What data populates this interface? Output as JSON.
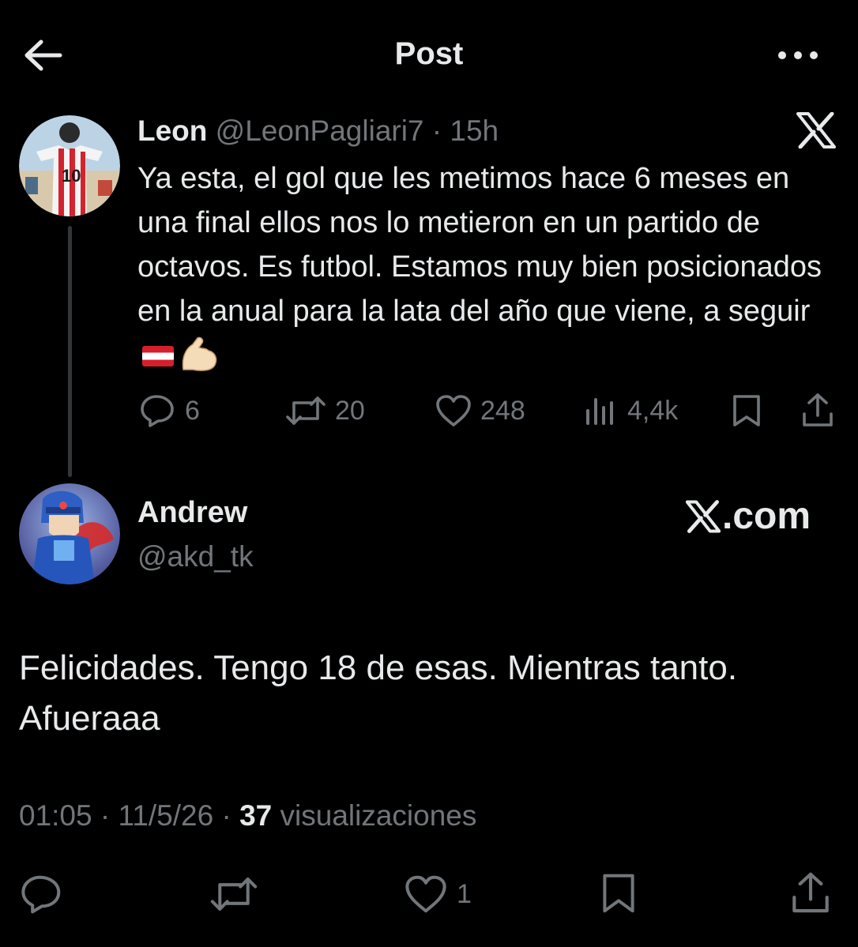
{
  "header": {
    "title": "Post",
    "back_icon": "arrow-left-icon",
    "more_icon": "more-dots-icon"
  },
  "parent_post": {
    "author_name": "Leon",
    "author_handle": "@LeonPagliari7",
    "separator": "·",
    "time": "15h",
    "text": "Ya esta, el gol que les metimos hace 6 meses en una final ellos nos lo metieron en un partido de octavos. Es futbol. Estamos muy bien posicionados en la anual para la lata del año que viene, a seguir",
    "emoji": [
      "flag-icon",
      "flexed-biceps-icon"
    ],
    "stats": {
      "replies": "6",
      "reposts": "20",
      "likes": "248",
      "views": "4,4k"
    }
  },
  "reply_post": {
    "author_name": "Andrew",
    "author_handle": "@akd_tk",
    "watermark": ".com",
    "text": "Felicidades. Tengo 18 de esas. Mientras tanto. Afueraaa",
    "time": "01:05",
    "separator1": "·",
    "date": "11/5/26",
    "separator2": "·",
    "views_count": "37",
    "views_label": "visualizaciones",
    "likes": "1"
  },
  "colors": {
    "background": "#000000",
    "text": "#e7e9ea",
    "muted": "#71767b"
  }
}
